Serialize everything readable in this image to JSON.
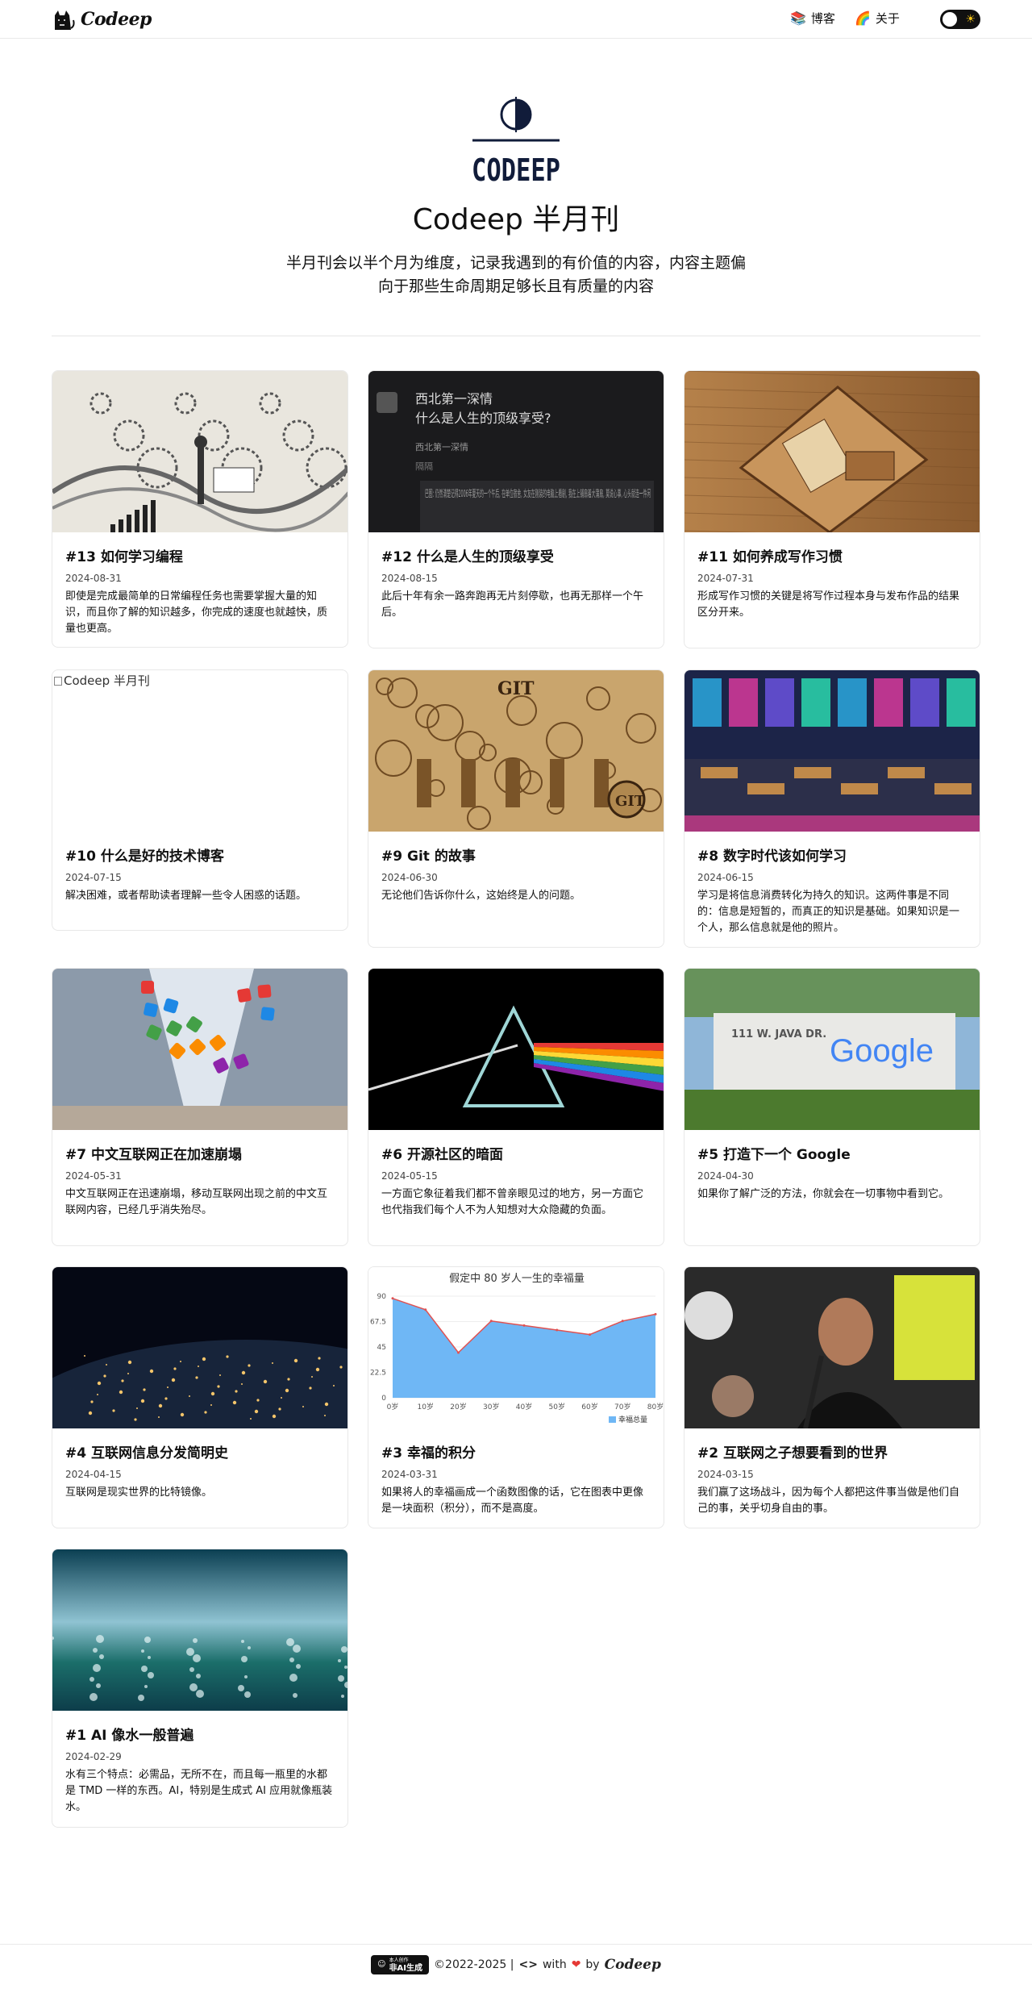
{
  "header": {
    "brand": "Codeep",
    "nav": [
      {
        "icon": "books-icon",
        "glyph": "📚",
        "label": "博客"
      },
      {
        "icon": "rainbow-icon",
        "glyph": "🌈",
        "label": "关于"
      }
    ],
    "theme_toggle_icon": "sun-icon"
  },
  "hero": {
    "logo_text": "CODEEP",
    "title": "Codeep 半月刊",
    "description": "半月刊会以半个月为维度，记录我遇到的有价值的内容，内容主题偏向于那些生命周期足够长且有质量的内容"
  },
  "posts": [
    {
      "title": "#13 如何学习编程",
      "date": "2024-08-31",
      "summary": "即使是完成最简单的日常编程任务也需要掌握大量的知识，而且你了解的知识越多，你完成的速度也就越快，质量也更高。",
      "thumb": "sketch-gears"
    },
    {
      "title": "#12 什么是人生的顶级享受",
      "date": "2024-08-15",
      "summary": "此后十年有余一路奔跑再无片刻停歇，也再无那样一个午后。",
      "thumb": "dark-post",
      "thumb_text": {
        "author": "西北第一深情",
        "question": "什么是人生的顶级享受?",
        "sub": "西北第一深情",
        "meta": "隔隔",
        "quote": "巴图: 仍然清楚记得2006年夏天的一个午后, 在单位宿舍, 女友在刚装的电脑上看剧, 我在上铺扇着大蒲扇, 莫说心事, 心头就连一件闲"
      }
    },
    {
      "title": "#11 如何养成写作习惯",
      "date": "2024-07-31",
      "summary": "形成写作习惯的关键是将写作过程本身与发布作品的结果区分开来。",
      "thumb": "wood-carving"
    },
    {
      "title": "#10 什么是好的技术博客",
      "date": "2024-07-15",
      "summary": "解决困难，或者帮助读者理解一些令人困惑的话题。",
      "thumb": "broken",
      "alt": "Codeep 半月刊"
    },
    {
      "title": "#9 Git 的故事",
      "date": "2024-06-30",
      "summary": "无论他们告诉你什么，这始终是人的问题。",
      "thumb": "git-story"
    },
    {
      "title": "#8 数字时代该如何学习",
      "date": "2024-06-15",
      "summary": "学习是将信息消费转化为持久的知识。这两件事是不同的：信息是短暂的，而真正的知识是基础。如果知识是一个人，那么信息就是他的照片。",
      "thumb": "classroom"
    },
    {
      "title": "#7 中文互联网正在加速崩塌",
      "date": "2024-05-31",
      "summary": "中文互联网正在迅速崩塌，移动互联网出现之前的中文互联网内容，已经几乎消失殆尽。",
      "thumb": "collapse"
    },
    {
      "title": "#6 开源社区的暗面",
      "date": "2024-05-15",
      "summary": "一方面它象征着我们都不曾亲眼见过的地方，另一方面它也代指我们每个人不为人知想对大众隐藏的负面。",
      "thumb": "prism"
    },
    {
      "title": "#5 打造下一个 Google",
      "date": "2024-04-30",
      "summary": "如果你了解广泛的方法，你就会在一切事物中看到它。",
      "thumb": "google-sign",
      "thumb_text": {
        "street": "111 W. JAVA DR.",
        "logo": "Google"
      }
    },
    {
      "title": "#4 互联网信息分发简明史",
      "date": "2024-04-15",
      "summary": "互联网是现实世界的比特镜像。",
      "thumb": "earth-night"
    },
    {
      "title": "#3 幸福的积分",
      "date": "2024-03-31",
      "summary": "如果将人的幸福画成一个函数图像的话，它在图表中更像是一块面积（积分），而不是高度。",
      "thumb": "chart",
      "chart": {
        "title": "假定中 80 岁人一生的幸福量",
        "categories": [
          "0岁",
          "10岁",
          "20岁",
          "30岁",
          "40岁",
          "50岁",
          "60岁",
          "70岁",
          "80岁"
        ],
        "values": [
          88,
          78,
          40,
          68,
          64,
          60,
          56,
          68,
          74
        ],
        "yticks": [
          "0",
          "22.5",
          "45",
          "67.5",
          "90"
        ],
        "ylim": [
          0,
          90
        ],
        "legend": "幸福总量"
      }
    },
    {
      "title": "#2 互联网之子想要看到的世界",
      "date": "2024-03-15",
      "summary": "我们赢了这场战斗，因为每个人都把这件事当做是他们自己的事，关乎切身自由的事。",
      "thumb": "speaker"
    },
    {
      "title": "#1 AI 像水一般普遍",
      "date": "2024-02-29",
      "summary": "水有三个特点：必需品，无所不在，而且每一瓶里的水都是 TMD 一样的东西。AI，特别是生成式 AI 应用就像瓶装水。",
      "thumb": "water"
    }
  ],
  "footer": {
    "badge_top": "本人创作",
    "badge": "非AI生成",
    "copyright": "©2022-2025 |",
    "code_glyph": "<>",
    "with": "with",
    "heart": "❤",
    "by": "by",
    "brand": "Codeep"
  }
}
